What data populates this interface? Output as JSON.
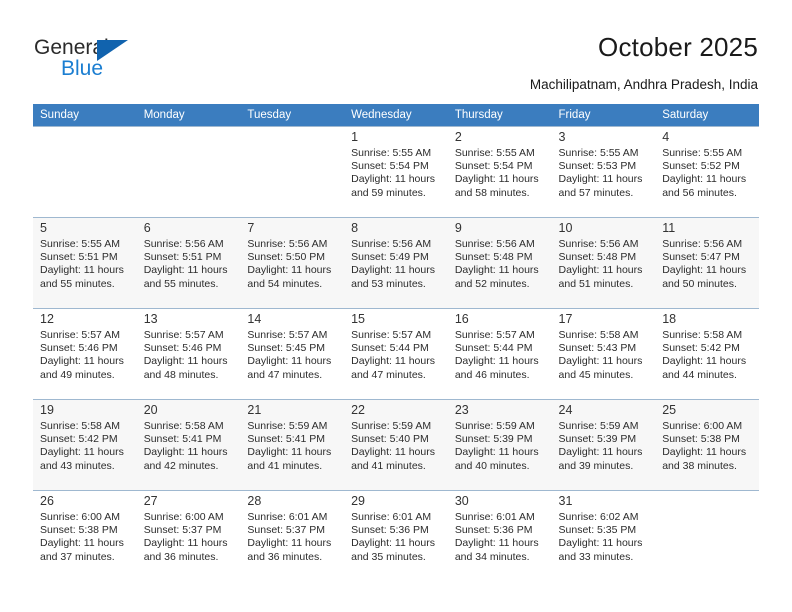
{
  "brand": {
    "name_top": "General",
    "name_bottom": "Blue",
    "accent_color": "#1163ae",
    "accent_text_color": "#1b7ed1",
    "triangle_icon": "triangle-icon"
  },
  "header": {
    "title": "October 2025",
    "subtitle": "Machilipatnam, Andhra Pradesh, India"
  },
  "calendar": {
    "header_bg": "#3b7dbf",
    "header_text_color": "#ffffff",
    "alt_row_bg": "#f7f7f7",
    "weekdays": [
      "Sunday",
      "Monday",
      "Tuesday",
      "Wednesday",
      "Thursday",
      "Friday",
      "Saturday"
    ],
    "weeks": [
      [
        {
          "day": "",
          "sunrise": "",
          "sunset": "",
          "daylight_line1": "",
          "daylight_line2": ""
        },
        {
          "day": "",
          "sunrise": "",
          "sunset": "",
          "daylight_line1": "",
          "daylight_line2": ""
        },
        {
          "day": "",
          "sunrise": "",
          "sunset": "",
          "daylight_line1": "",
          "daylight_line2": ""
        },
        {
          "day": "1",
          "sunrise": "Sunrise: 5:55 AM",
          "sunset": "Sunset: 5:54 PM",
          "daylight_line1": "Daylight: 11 hours",
          "daylight_line2": "and 59 minutes."
        },
        {
          "day": "2",
          "sunrise": "Sunrise: 5:55 AM",
          "sunset": "Sunset: 5:54 PM",
          "daylight_line1": "Daylight: 11 hours",
          "daylight_line2": "and 58 minutes."
        },
        {
          "day": "3",
          "sunrise": "Sunrise: 5:55 AM",
          "sunset": "Sunset: 5:53 PM",
          "daylight_line1": "Daylight: 11 hours",
          "daylight_line2": "and 57 minutes."
        },
        {
          "day": "4",
          "sunrise": "Sunrise: 5:55 AM",
          "sunset": "Sunset: 5:52 PM",
          "daylight_line1": "Daylight: 11 hours",
          "daylight_line2": "and 56 minutes."
        }
      ],
      [
        {
          "day": "5",
          "sunrise": "Sunrise: 5:55 AM",
          "sunset": "Sunset: 5:51 PM",
          "daylight_line1": "Daylight: 11 hours",
          "daylight_line2": "and 55 minutes."
        },
        {
          "day": "6",
          "sunrise": "Sunrise: 5:56 AM",
          "sunset": "Sunset: 5:51 PM",
          "daylight_line1": "Daylight: 11 hours",
          "daylight_line2": "and 55 minutes."
        },
        {
          "day": "7",
          "sunrise": "Sunrise: 5:56 AM",
          "sunset": "Sunset: 5:50 PM",
          "daylight_line1": "Daylight: 11 hours",
          "daylight_line2": "and 54 minutes."
        },
        {
          "day": "8",
          "sunrise": "Sunrise: 5:56 AM",
          "sunset": "Sunset: 5:49 PM",
          "daylight_line1": "Daylight: 11 hours",
          "daylight_line2": "and 53 minutes."
        },
        {
          "day": "9",
          "sunrise": "Sunrise: 5:56 AM",
          "sunset": "Sunset: 5:48 PM",
          "daylight_line1": "Daylight: 11 hours",
          "daylight_line2": "and 52 minutes."
        },
        {
          "day": "10",
          "sunrise": "Sunrise: 5:56 AM",
          "sunset": "Sunset: 5:48 PM",
          "daylight_line1": "Daylight: 11 hours",
          "daylight_line2": "and 51 minutes."
        },
        {
          "day": "11",
          "sunrise": "Sunrise: 5:56 AM",
          "sunset": "Sunset: 5:47 PM",
          "daylight_line1": "Daylight: 11 hours",
          "daylight_line2": "and 50 minutes."
        }
      ],
      [
        {
          "day": "12",
          "sunrise": "Sunrise: 5:57 AM",
          "sunset": "Sunset: 5:46 PM",
          "daylight_line1": "Daylight: 11 hours",
          "daylight_line2": "and 49 minutes."
        },
        {
          "day": "13",
          "sunrise": "Sunrise: 5:57 AM",
          "sunset": "Sunset: 5:46 PM",
          "daylight_line1": "Daylight: 11 hours",
          "daylight_line2": "and 48 minutes."
        },
        {
          "day": "14",
          "sunrise": "Sunrise: 5:57 AM",
          "sunset": "Sunset: 5:45 PM",
          "daylight_line1": "Daylight: 11 hours",
          "daylight_line2": "and 47 minutes."
        },
        {
          "day": "15",
          "sunrise": "Sunrise: 5:57 AM",
          "sunset": "Sunset: 5:44 PM",
          "daylight_line1": "Daylight: 11 hours",
          "daylight_line2": "and 47 minutes."
        },
        {
          "day": "16",
          "sunrise": "Sunrise: 5:57 AM",
          "sunset": "Sunset: 5:44 PM",
          "daylight_line1": "Daylight: 11 hours",
          "daylight_line2": "and 46 minutes."
        },
        {
          "day": "17",
          "sunrise": "Sunrise: 5:58 AM",
          "sunset": "Sunset: 5:43 PM",
          "daylight_line1": "Daylight: 11 hours",
          "daylight_line2": "and 45 minutes."
        },
        {
          "day": "18",
          "sunrise": "Sunrise: 5:58 AM",
          "sunset": "Sunset: 5:42 PM",
          "daylight_line1": "Daylight: 11 hours",
          "daylight_line2": "and 44 minutes."
        }
      ],
      [
        {
          "day": "19",
          "sunrise": "Sunrise: 5:58 AM",
          "sunset": "Sunset: 5:42 PM",
          "daylight_line1": "Daylight: 11 hours",
          "daylight_line2": "and 43 minutes."
        },
        {
          "day": "20",
          "sunrise": "Sunrise: 5:58 AM",
          "sunset": "Sunset: 5:41 PM",
          "daylight_line1": "Daylight: 11 hours",
          "daylight_line2": "and 42 minutes."
        },
        {
          "day": "21",
          "sunrise": "Sunrise: 5:59 AM",
          "sunset": "Sunset: 5:41 PM",
          "daylight_line1": "Daylight: 11 hours",
          "daylight_line2": "and 41 minutes."
        },
        {
          "day": "22",
          "sunrise": "Sunrise: 5:59 AM",
          "sunset": "Sunset: 5:40 PM",
          "daylight_line1": "Daylight: 11 hours",
          "daylight_line2": "and 41 minutes."
        },
        {
          "day": "23",
          "sunrise": "Sunrise: 5:59 AM",
          "sunset": "Sunset: 5:39 PM",
          "daylight_line1": "Daylight: 11 hours",
          "daylight_line2": "and 40 minutes."
        },
        {
          "day": "24",
          "sunrise": "Sunrise: 5:59 AM",
          "sunset": "Sunset: 5:39 PM",
          "daylight_line1": "Daylight: 11 hours",
          "daylight_line2": "and 39 minutes."
        },
        {
          "day": "25",
          "sunrise": "Sunrise: 6:00 AM",
          "sunset": "Sunset: 5:38 PM",
          "daylight_line1": "Daylight: 11 hours",
          "daylight_line2": "and 38 minutes."
        }
      ],
      [
        {
          "day": "26",
          "sunrise": "Sunrise: 6:00 AM",
          "sunset": "Sunset: 5:38 PM",
          "daylight_line1": "Daylight: 11 hours",
          "daylight_line2": "and 37 minutes."
        },
        {
          "day": "27",
          "sunrise": "Sunrise: 6:00 AM",
          "sunset": "Sunset: 5:37 PM",
          "daylight_line1": "Daylight: 11 hours",
          "daylight_line2": "and 36 minutes."
        },
        {
          "day": "28",
          "sunrise": "Sunrise: 6:01 AM",
          "sunset": "Sunset: 5:37 PM",
          "daylight_line1": "Daylight: 11 hours",
          "daylight_line2": "and 36 minutes."
        },
        {
          "day": "29",
          "sunrise": "Sunrise: 6:01 AM",
          "sunset": "Sunset: 5:36 PM",
          "daylight_line1": "Daylight: 11 hours",
          "daylight_line2": "and 35 minutes."
        },
        {
          "day": "30",
          "sunrise": "Sunrise: 6:01 AM",
          "sunset": "Sunset: 5:36 PM",
          "daylight_line1": "Daylight: 11 hours",
          "daylight_line2": "and 34 minutes."
        },
        {
          "day": "31",
          "sunrise": "Sunrise: 6:02 AM",
          "sunset": "Sunset: 5:35 PM",
          "daylight_line1": "Daylight: 11 hours",
          "daylight_line2": "and 33 minutes."
        },
        {
          "day": "",
          "sunrise": "",
          "sunset": "",
          "daylight_line1": "",
          "daylight_line2": ""
        }
      ]
    ]
  }
}
